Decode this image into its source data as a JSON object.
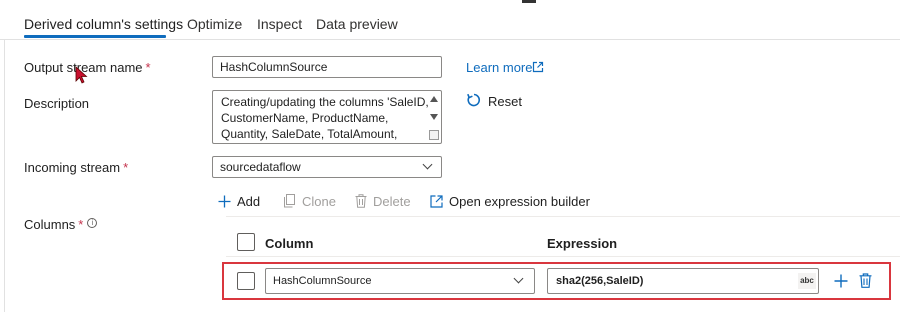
{
  "tabs": [
    {
      "label": "Derived column's settings",
      "active": true
    },
    {
      "label": "Optimize",
      "active": false
    },
    {
      "label": "Inspect",
      "active": false
    },
    {
      "label": "Data preview",
      "active": false
    }
  ],
  "form": {
    "output_stream": {
      "label": "Output stream name",
      "required_mark": "*",
      "value": "HashColumnSource"
    },
    "description": {
      "label": "Description",
      "value": "Creating/updating the columns 'SaleID,\nCustomerName, ProductName,\nQuantity, SaleDate, TotalAmount,"
    },
    "incoming_stream": {
      "label": "Incoming stream",
      "required_mark": "*",
      "value": "sourcedataflow"
    },
    "columns": {
      "label": "Columns",
      "required_mark": "*",
      "info_icon": "i"
    }
  },
  "links": {
    "learn_more": "Learn more",
    "reset": "Reset"
  },
  "toolbar": {
    "add": "Add",
    "clone": "Clone",
    "delete": "Delete",
    "open_expression_builder": "Open expression builder"
  },
  "grid": {
    "headers": {
      "column": "Column",
      "expression": "Expression"
    },
    "rows": [
      {
        "column": "HashColumnSource",
        "expression": "sha2(256,SaleID)",
        "type_badge": "abc"
      }
    ]
  },
  "colors": {
    "accent": "#0f6cbd",
    "highlight": "#d9363e",
    "required": "#c4314b"
  }
}
